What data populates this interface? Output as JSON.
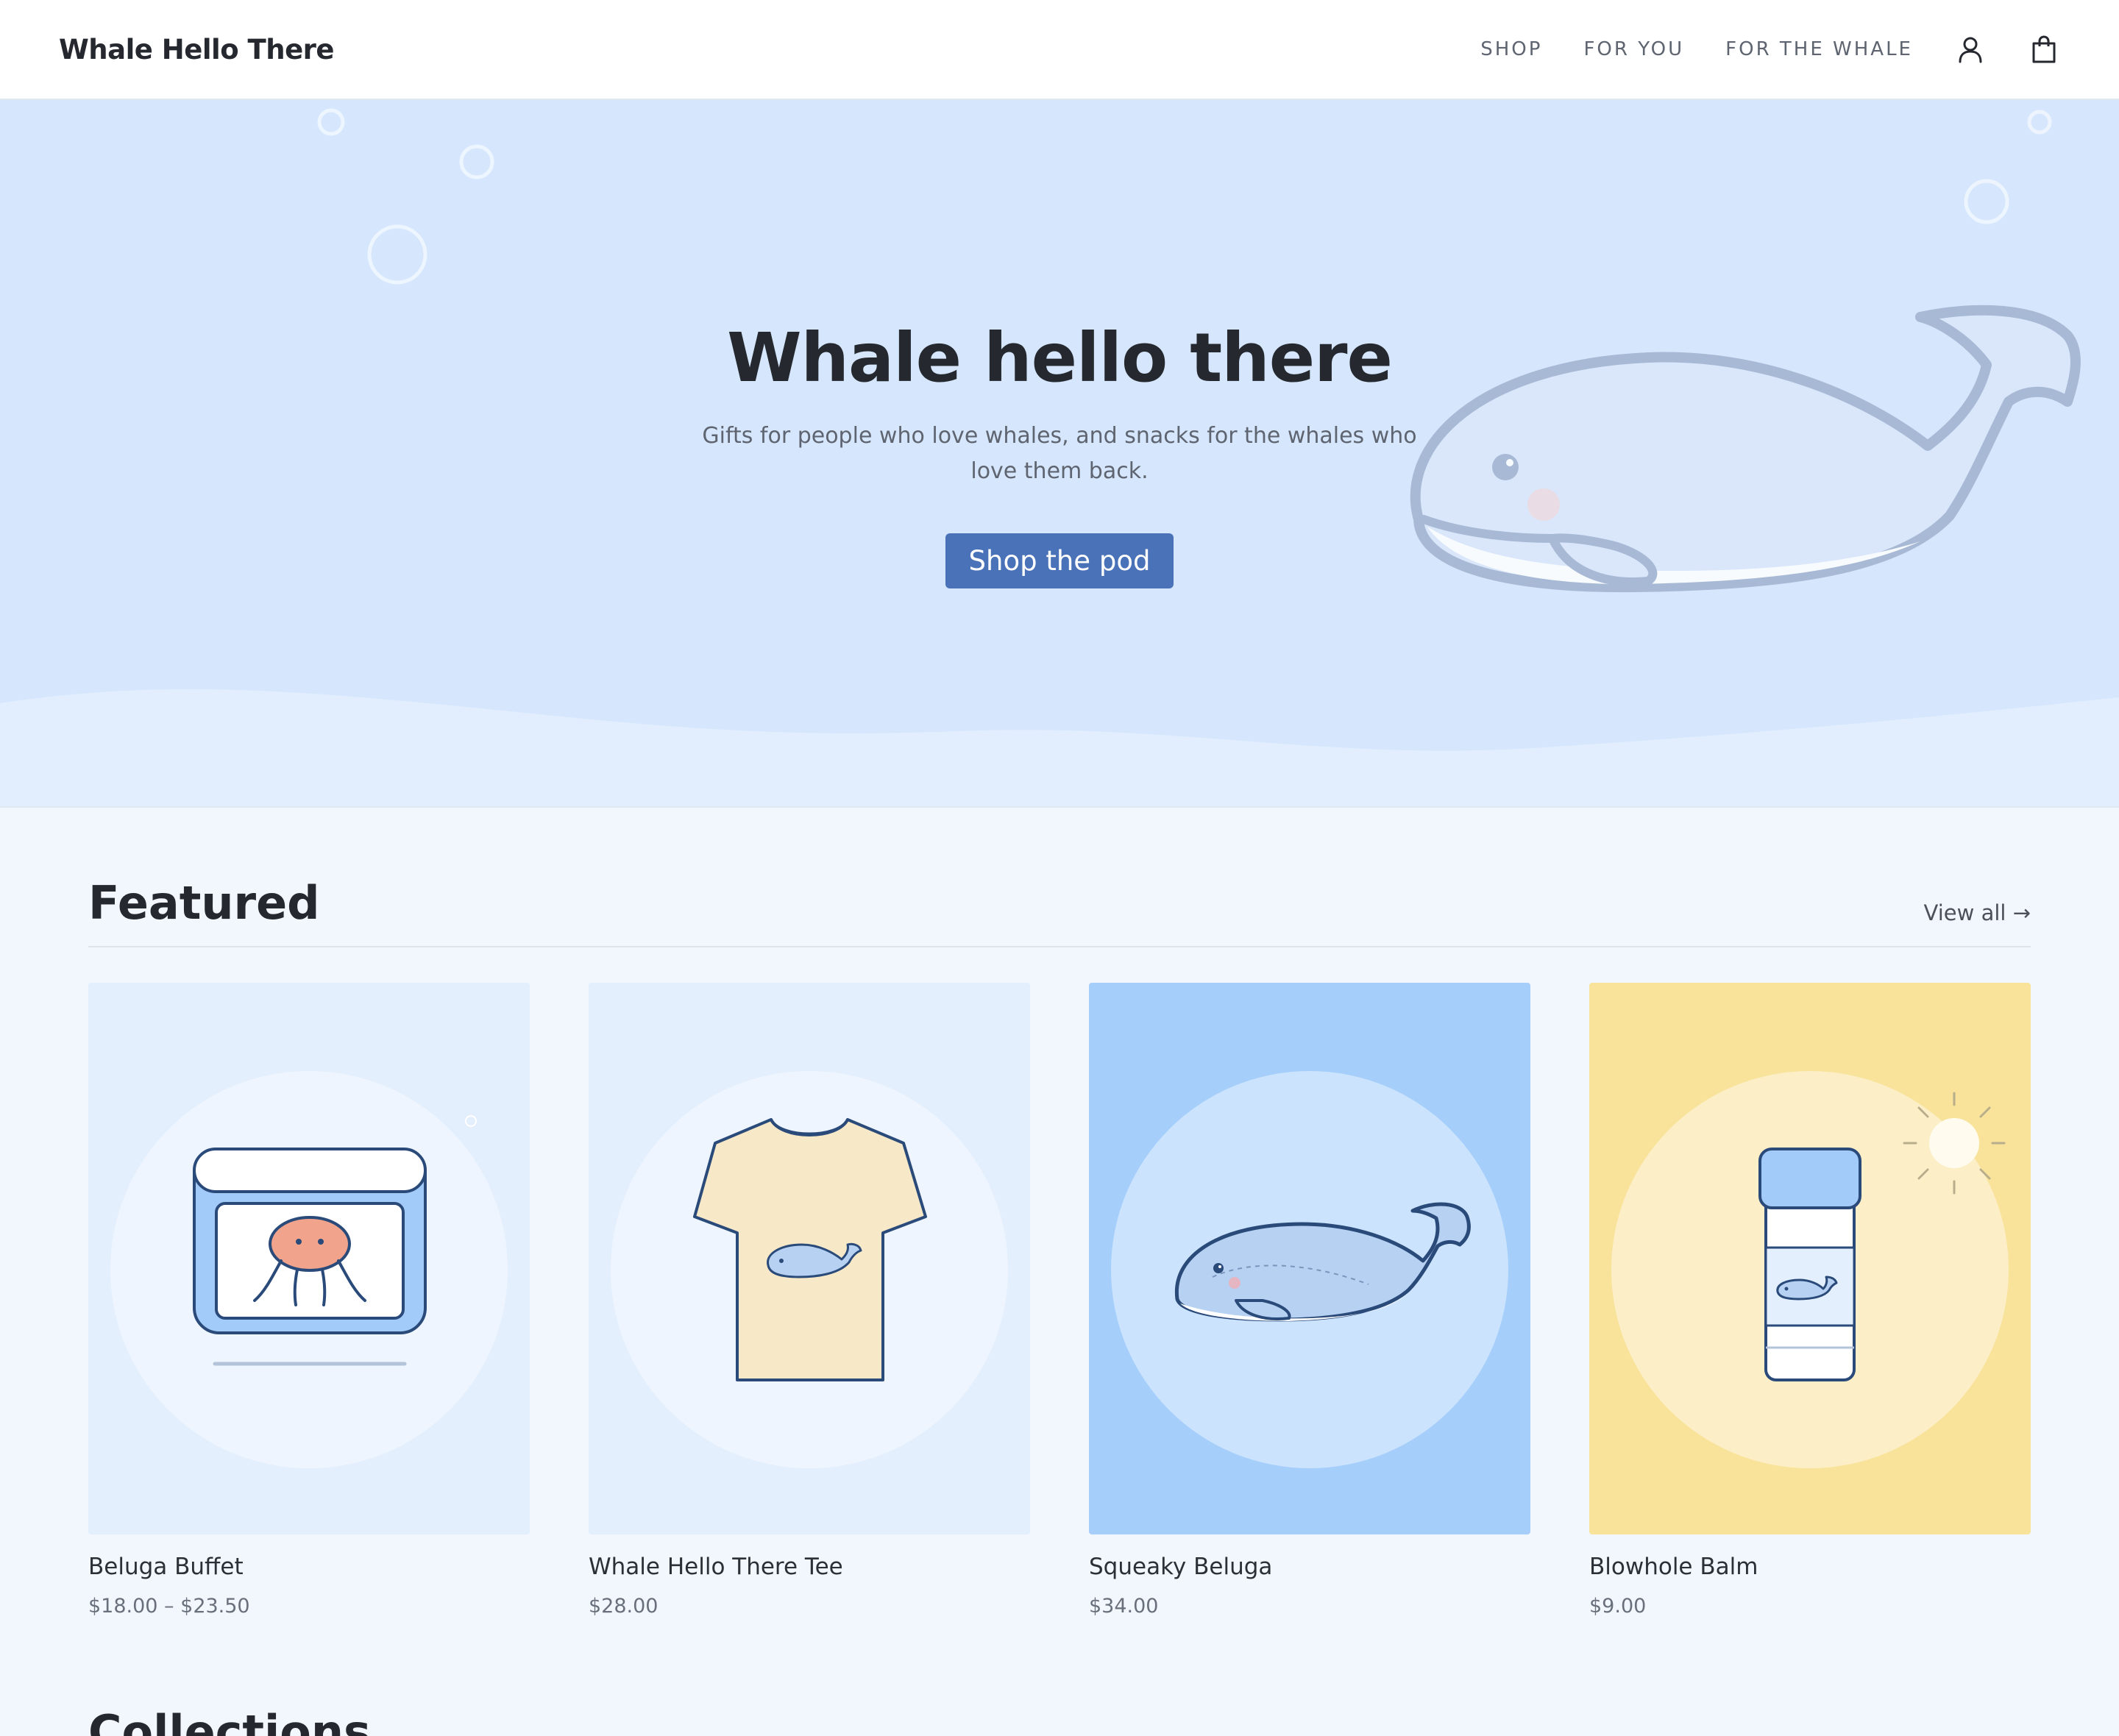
{
  "header": {
    "brand": "Whale Hello There",
    "nav": [
      "SHOP",
      "FOR YOU",
      "FOR THE WHALE"
    ],
    "icons": [
      "account-icon",
      "bag-icon"
    ]
  },
  "hero": {
    "title": "Whale hello there",
    "subtitle": "Gifts for people who love whales, and snacks for the whales who love them back.",
    "cta": "Shop the pod"
  },
  "featured": {
    "title": "Featured",
    "view_all": "View all →",
    "products": [
      {
        "name": "Beluga Buffet",
        "price": "$18.00 – $23.50",
        "bg": "#e4effd",
        "illustration": "jellyfish-tin"
      },
      {
        "name": "Whale Hello There Tee",
        "price": "$28.00",
        "bg": "#e4effd",
        "illustration": "whale-tee"
      },
      {
        "name": "Squeaky Beluga",
        "price": "$34.00",
        "bg": "#a5cefb",
        "illustration": "beluga-toy"
      },
      {
        "name": "Blowhole Balm",
        "price": "$9.00",
        "bg": "#f9e39b",
        "illustration": "balm-tube"
      }
    ]
  },
  "collections": {
    "title": "Collections"
  },
  "colors": {
    "accent": "#4a72b8",
    "hero_bg": "#d6e7fd",
    "page_bg": "#f2f7fd",
    "outline": "#2a4a7a"
  }
}
